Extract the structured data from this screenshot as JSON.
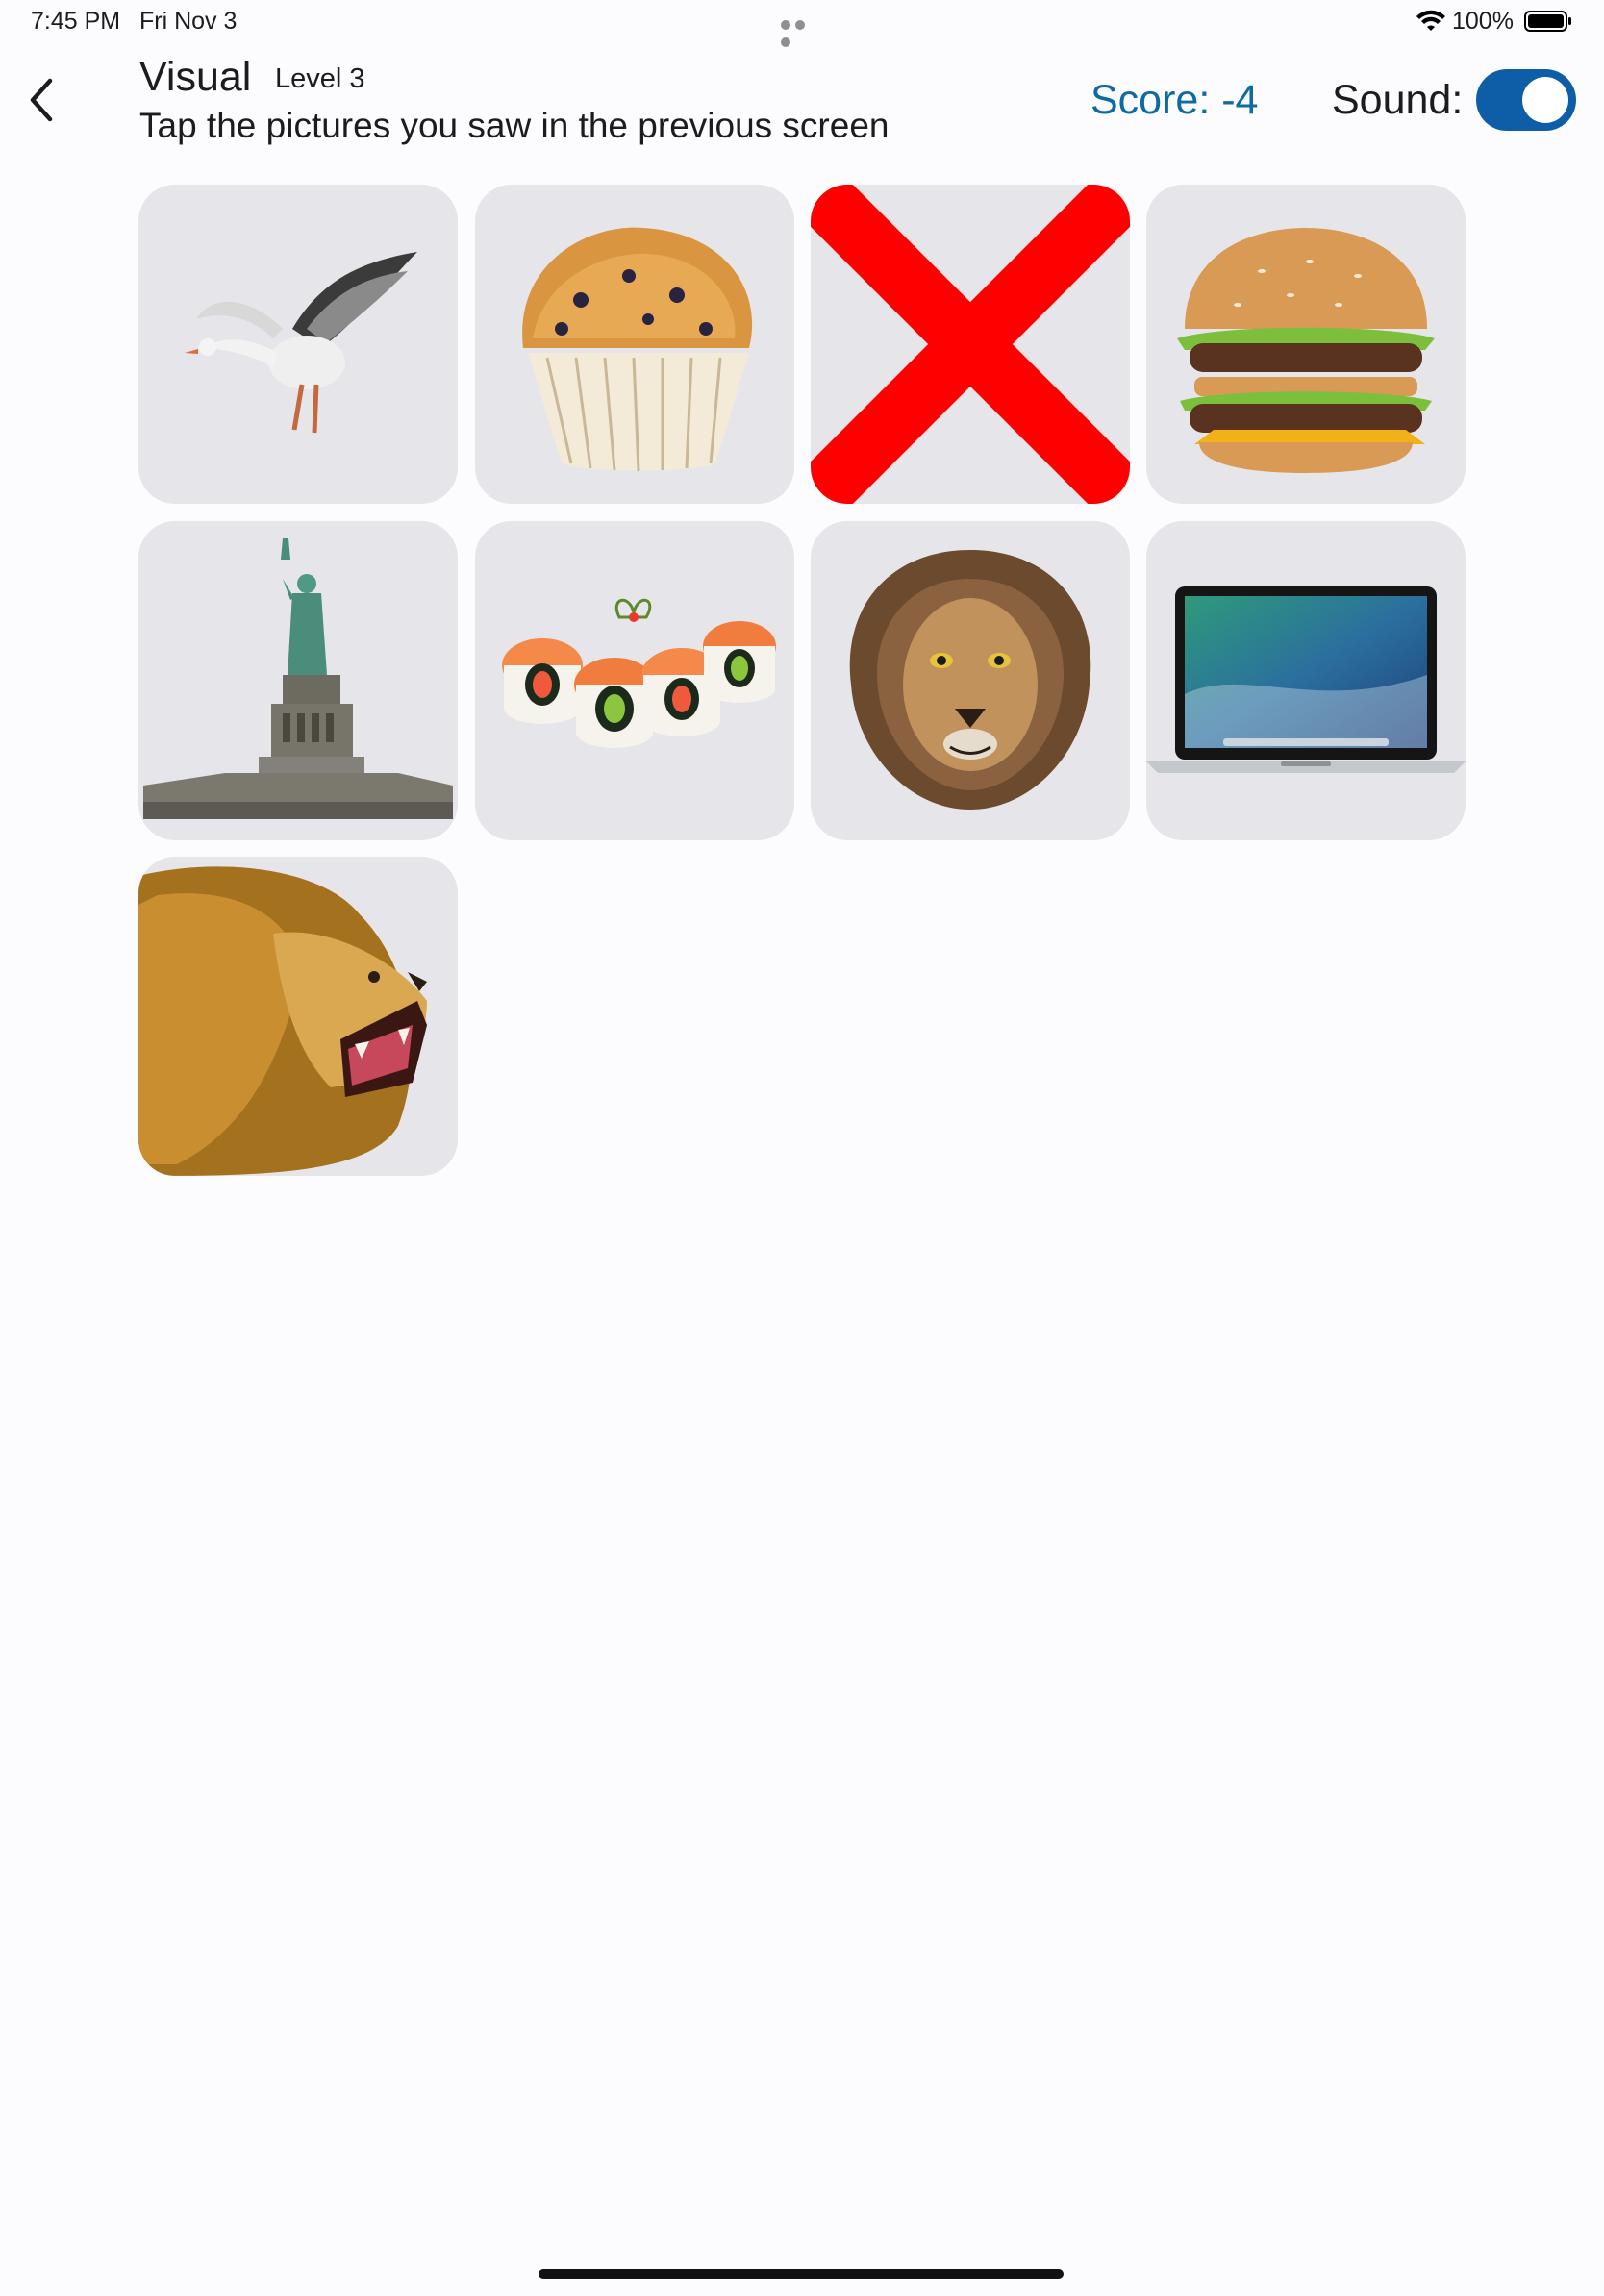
{
  "status_bar": {
    "time": "7:45 PM",
    "date": "Fri Nov 3",
    "battery": "100%"
  },
  "header": {
    "back_icon": "chevron-left-icon",
    "title": "Visual",
    "level": "Level 3",
    "instruction": "Tap the pictures you saw in the previous screen",
    "score": "Score: -4",
    "sound_label": "Sound:",
    "sound_on": true
  },
  "tiles": [
    {
      "subject": "goose",
      "state": "normal"
    },
    {
      "subject": "blueberry-muffin",
      "state": "normal"
    },
    {
      "subject": "wrong-mark",
      "state": "wrong"
    },
    {
      "subject": "hamburger",
      "state": "normal"
    },
    {
      "subject": "statue-of-liberty",
      "state": "normal"
    },
    {
      "subject": "sushi-rolls",
      "state": "normal"
    },
    {
      "subject": "lion-head",
      "state": "normal"
    },
    {
      "subject": "laptop",
      "state": "normal"
    },
    {
      "subject": "roaring-lion",
      "state": "normal"
    }
  ],
  "colors": {
    "accent": "#0d6aa3",
    "toggle": "#0d5ea6",
    "tile_bg": "#e5e5ea",
    "wrong_mark": "#ff0000"
  }
}
